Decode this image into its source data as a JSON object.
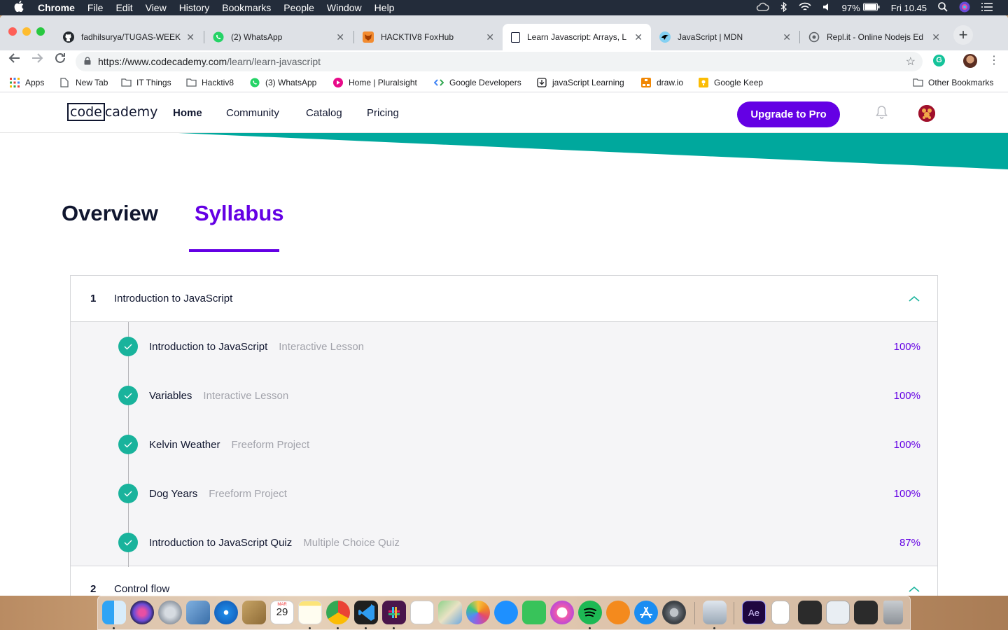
{
  "menubar": {
    "apple_icon": "apple-icon",
    "items": [
      "Chrome",
      "File",
      "Edit",
      "View",
      "History",
      "Bookmarks",
      "People",
      "Window",
      "Help"
    ],
    "battery": "97%",
    "clock": "Fri 10.45"
  },
  "browser": {
    "tabs": [
      {
        "title": "fadhilsurya/TUGAS-WEEK",
        "icon": "github-icon"
      },
      {
        "title": "(2) WhatsApp",
        "icon": "whatsapp-icon"
      },
      {
        "title": "HACKTIV8 FoxHub",
        "icon": "foxhub-icon"
      },
      {
        "title": "Learn Javascript: Arrays, L",
        "icon": "codecademy-icon"
      },
      {
        "title": "JavaScript | MDN",
        "icon": "mdn-icon"
      },
      {
        "title": "Repl.it - Online Nodejs Ed",
        "icon": "replit-icon"
      }
    ],
    "url_host": "https://www.codecademy.com",
    "url_path": "/learn/learn-javascript",
    "bookmarks": [
      "Apps",
      "New Tab",
      "IT Things",
      "Hacktiv8",
      "(3) WhatsApp",
      "Home | Pluralsight",
      "Google Developers",
      "javaScript Learning",
      "draw.io",
      "Google Keep"
    ],
    "other_bookmarks": "Other Bookmarks"
  },
  "site": {
    "logo_boxed": "code",
    "logo_rest": "cademy",
    "nav": [
      "Home",
      "Community",
      "Catalog",
      "Pricing"
    ],
    "upgrade_label": "Upgrade to Pro",
    "accent": "#6400e4",
    "teal": "#00a89d"
  },
  "tabs": {
    "overview": "Overview",
    "syllabus": "Syllabus"
  },
  "modules": [
    {
      "number": "1",
      "title": "Introduction to JavaScript",
      "lessons": [
        {
          "name": "Introduction to JavaScript",
          "type": "Interactive Lesson",
          "progress": "100%"
        },
        {
          "name": "Variables",
          "type": "Interactive Lesson",
          "progress": "100%"
        },
        {
          "name": "Kelvin Weather",
          "type": "Freeform Project",
          "progress": "100%"
        },
        {
          "name": "Dog Years",
          "type": "Freeform Project",
          "progress": "100%"
        },
        {
          "name": "Introduction to JavaScript Quiz",
          "type": "Multiple Choice Quiz",
          "progress": "87%"
        }
      ]
    },
    {
      "number": "2",
      "title": "Control flow"
    }
  ],
  "dock": {
    "calendar_month": "MAR",
    "calendar_day": "29",
    "apps": [
      "finder-icon",
      "siri-icon",
      "launchpad-icon",
      "preview-icon",
      "safari-icon",
      "notefile-icon",
      "calendar-icon",
      "notes-icon",
      "chrome-icon",
      "vscode-icon",
      "slack-icon",
      "reminders-icon",
      "maps-icon",
      "photos-icon",
      "messages-icon",
      "facetime-icon",
      "itunes-icon",
      "spotify-icon",
      "books-icon",
      "appstore-icon",
      "system-preferences-icon",
      "image-capture-icon",
      "after-effects-icon",
      "document-icon",
      "screenshot-icon",
      "window-icon",
      "terminal-icon",
      "trash-icon"
    ]
  }
}
